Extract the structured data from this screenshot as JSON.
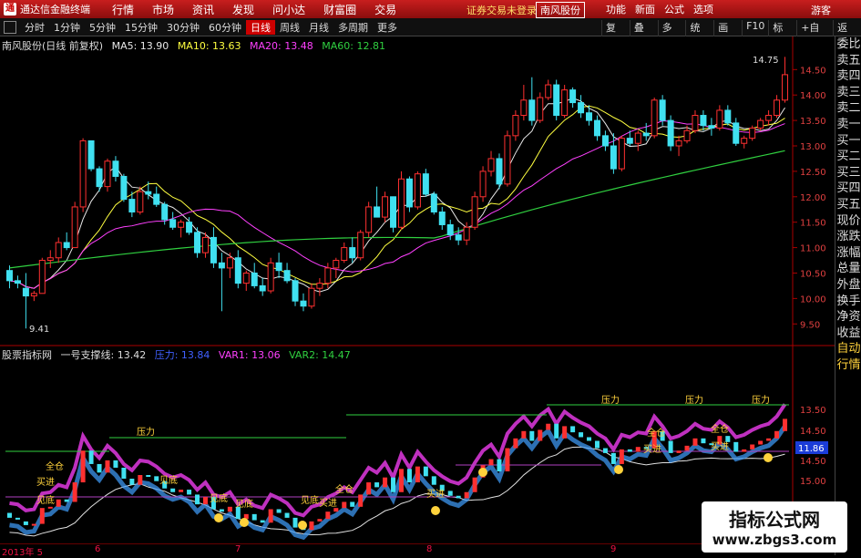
{
  "titlebar": {
    "app": "通达信金融终端",
    "menus": [
      "行情",
      "市场",
      "资讯",
      "发现",
      "问小达",
      "财富圈",
      "交易"
    ],
    "warning": "证券交易未登录",
    "stock": "南风股份",
    "right": [
      "功能",
      "新面",
      "公式",
      "选项"
    ],
    "guest": "游客"
  },
  "toolbar": {
    "timeframes": [
      "分时",
      "1分钟",
      "5分钟",
      "15分钟",
      "30分钟",
      "60分钟",
      "日线",
      "周线",
      "月线",
      "多周期",
      "更多"
    ],
    "active": "日线",
    "right": [
      "复权",
      "叠加",
      "多股",
      "统计",
      "画线",
      "F10",
      "标记",
      "+自选",
      "返回"
    ]
  },
  "main_header": {
    "stock": "南风股份(日线 前复权)",
    "ma5": "MA5: 13.90",
    "ma10": "MA10: 13.63",
    "ma20": "MA20: 13.48",
    "ma60": "MA60: 12.81"
  },
  "indicator_header": {
    "name": "股票指标网",
    "line1": "一号支撑线: 13.42",
    "line2": "压力: 13.84",
    "var1": "VAR1: 13.06",
    "var2": "VAR2: 14.47"
  },
  "sidebar": [
    "委比",
    "卖五",
    "卖四",
    "卖三",
    "卖二",
    "卖一",
    "买一",
    "买二",
    "买三",
    "买四",
    "买五",
    "现价",
    "涨跌",
    "涨幅",
    "总量",
    "外盘",
    "换手",
    "净资",
    "收益",
    "自动",
    "行情"
  ],
  "annotations": {
    "high": "14.75",
    "low": "9.41",
    "current": "11.86"
  },
  "labels": {
    "pressure": "压力",
    "buy": "买进",
    "bottom": "见底",
    "full": "全仓"
  },
  "dates": [
    "2013年 5",
    "6",
    "7",
    "8",
    "9"
  ],
  "watermark": {
    "line1": "指标公式网",
    "line2": "www.zbgs3.com"
  },
  "colors": {
    "up": "#ff3030",
    "down": "#40e0f0",
    "ma5": "#e8e8e8",
    "ma10": "#ffff40",
    "ma20": "#ff40ff",
    "ma60": "#30d040"
  },
  "chart_data": {
    "type": "candlestick",
    "price_axis": {
      "ticks": [
        9.5,
        10.0,
        10.5,
        11.0,
        11.5,
        12.0,
        12.5,
        13.0,
        13.5,
        14.0,
        14.5
      ],
      "ylim": [
        9.2,
        14.9
      ]
    },
    "indicator_axis": {
      "ticks": [
        13.5,
        14.5,
        14.5,
        14.5,
        15.0
      ],
      "labels": [
        "13.50",
        "14.50",
        "14.50",
        "14.50",
        "15.00"
      ]
    },
    "candles": [
      [
        10.55,
        10.65,
        10.2,
        10.35
      ],
      [
        10.35,
        10.45,
        10.2,
        10.3
      ],
      [
        10.2,
        10.5,
        9.41,
        10.05
      ],
      [
        10.05,
        10.15,
        9.95,
        10.1
      ],
      [
        10.1,
        10.8,
        10.1,
        10.75
      ],
      [
        10.75,
        10.95,
        10.6,
        10.8
      ],
      [
        10.8,
        11.2,
        10.7,
        11.1
      ],
      [
        11.1,
        11.3,
        10.95,
        11.0
      ],
      [
        11.0,
        11.9,
        11.0,
        11.8
      ],
      [
        11.8,
        13.15,
        11.7,
        13.1
      ],
      [
        13.1,
        13.1,
        12.5,
        12.55
      ],
      [
        12.55,
        12.6,
        12.1,
        12.2
      ],
      [
        12.2,
        12.75,
        12.1,
        12.7
      ],
      [
        12.7,
        12.8,
        12.3,
        12.4
      ],
      [
        12.4,
        12.45,
        11.9,
        11.95
      ],
      [
        11.95,
        12.1,
        11.6,
        11.7
      ],
      [
        11.7,
        12.2,
        11.65,
        12.1
      ],
      [
        12.1,
        12.3,
        11.95,
        12.05
      ],
      [
        12.05,
        12.2,
        11.8,
        11.85
      ],
      [
        11.85,
        11.9,
        11.45,
        11.55
      ],
      [
        11.55,
        11.7,
        11.35,
        11.4
      ],
      [
        11.4,
        11.55,
        11.2,
        11.5
      ],
      [
        11.5,
        11.6,
        11.25,
        11.3
      ],
      [
        11.3,
        11.4,
        10.8,
        10.9
      ],
      [
        10.9,
        11.3,
        10.8,
        11.2
      ],
      [
        11.2,
        11.4,
        10.6,
        10.7
      ],
      [
        10.7,
        10.9,
        9.75,
        10.6
      ],
      [
        10.6,
        10.9,
        10.4,
        10.8
      ],
      [
        10.8,
        10.95,
        10.2,
        10.3
      ],
      [
        10.3,
        10.55,
        10.15,
        10.5
      ],
      [
        10.5,
        10.7,
        10.2,
        10.25
      ],
      [
        10.25,
        10.4,
        10.05,
        10.15
      ],
      [
        10.15,
        10.8,
        10.1,
        10.7
      ],
      [
        10.7,
        10.9,
        10.4,
        10.55
      ],
      [
        10.55,
        10.7,
        10.3,
        10.35
      ],
      [
        10.35,
        10.4,
        9.85,
        9.95
      ],
      [
        9.95,
        10.1,
        9.75,
        9.85
      ],
      [
        9.85,
        10.3,
        9.8,
        10.2
      ],
      [
        10.2,
        10.4,
        10.05,
        10.3
      ],
      [
        10.3,
        10.7,
        10.2,
        10.6
      ],
      [
        10.6,
        10.8,
        10.4,
        10.75
      ],
      [
        10.75,
        11.1,
        10.7,
        11.0
      ],
      [
        11.0,
        11.2,
        10.7,
        10.8
      ],
      [
        10.8,
        11.35,
        10.75,
        11.3
      ],
      [
        11.3,
        11.9,
        11.2,
        11.8
      ],
      [
        11.8,
        12.2,
        11.7,
        11.6
      ],
      [
        11.6,
        12.1,
        11.5,
        12.0
      ],
      [
        12.0,
        11.9,
        11.3,
        11.4
      ],
      [
        11.4,
        12.5,
        11.35,
        12.35
      ],
      [
        12.35,
        12.4,
        11.7,
        11.8
      ],
      [
        11.8,
        12.5,
        11.75,
        12.45
      ],
      [
        12.45,
        12.55,
        12.0,
        12.05
      ],
      [
        12.05,
        12.1,
        11.65,
        11.7
      ],
      [
        11.7,
        11.8,
        11.35,
        11.45
      ],
      [
        11.45,
        11.55,
        11.15,
        11.25
      ],
      [
        11.25,
        11.4,
        11.05,
        11.15
      ],
      [
        11.15,
        11.5,
        11.05,
        11.4
      ],
      [
        11.4,
        12.1,
        11.35,
        12.0
      ],
      [
        12.0,
        12.6,
        11.9,
        12.5
      ],
      [
        12.5,
        12.9,
        12.4,
        12.75
      ],
      [
        12.75,
        12.85,
        12.15,
        12.25
      ],
      [
        12.25,
        13.3,
        12.2,
        13.2
      ],
      [
        13.2,
        13.7,
        13.1,
        13.6
      ],
      [
        13.6,
        14.2,
        13.5,
        13.9
      ],
      [
        13.9,
        14.35,
        13.4,
        13.5
      ],
      [
        13.5,
        14.05,
        13.45,
        13.95
      ],
      [
        13.95,
        14.3,
        13.9,
        14.2
      ],
      [
        14.2,
        14.3,
        13.5,
        13.6
      ],
      [
        13.6,
        14.2,
        13.55,
        14.1
      ],
      [
        14.1,
        14.15,
        13.75,
        13.85
      ],
      [
        13.85,
        14.0,
        13.55,
        13.65
      ],
      [
        13.65,
        13.8,
        13.4,
        13.5
      ],
      [
        13.5,
        13.6,
        13.1,
        13.2
      ],
      [
        13.2,
        13.3,
        12.9,
        13.0
      ],
      [
        13.0,
        13.25,
        12.45,
        12.55
      ],
      [
        12.55,
        13.2,
        12.5,
        13.15
      ],
      [
        13.15,
        13.3,
        13.0,
        13.05
      ],
      [
        13.05,
        13.3,
        12.9,
        13.25
      ],
      [
        13.25,
        13.45,
        13.1,
        13.2
      ],
      [
        13.2,
        13.95,
        13.15,
        13.9
      ],
      [
        13.9,
        14.0,
        13.4,
        13.5
      ],
      [
        13.5,
        13.6,
        12.9,
        13.0
      ],
      [
        13.0,
        13.2,
        12.8,
        13.1
      ],
      [
        13.1,
        13.4,
        13.05,
        13.3
      ],
      [
        13.3,
        13.7,
        13.25,
        13.6
      ],
      [
        13.6,
        13.7,
        13.3,
        13.4
      ],
      [
        13.4,
        13.55,
        13.2,
        13.35
      ],
      [
        13.35,
        13.8,
        13.3,
        13.7
      ],
      [
        13.7,
        13.8,
        13.4,
        13.45
      ],
      [
        13.45,
        13.55,
        13.0,
        13.05
      ],
      [
        13.05,
        13.2,
        12.95,
        13.15
      ],
      [
        13.15,
        13.4,
        13.1,
        13.35
      ],
      [
        13.35,
        13.55,
        13.3,
        13.5
      ],
      [
        13.5,
        13.7,
        13.4,
        13.6
      ],
      [
        13.6,
        14.0,
        13.55,
        13.9
      ],
      [
        13.9,
        14.75,
        13.85,
        14.4
      ]
    ]
  }
}
